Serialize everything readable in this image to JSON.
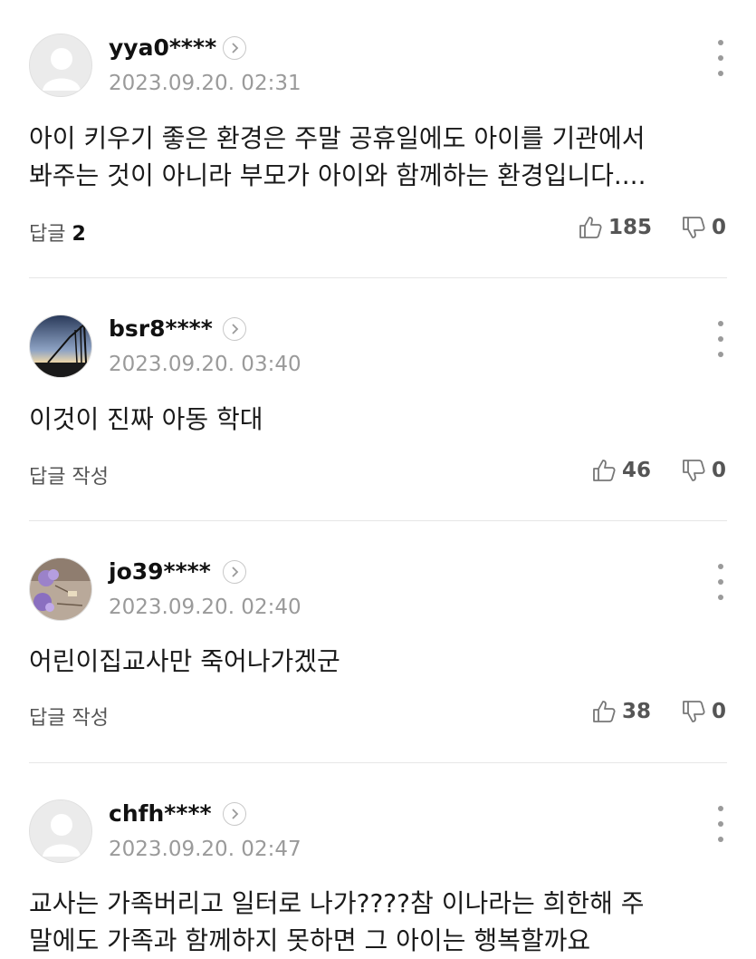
{
  "comments": [
    {
      "username": "yya0****",
      "date": "2023.09.20. 02:31",
      "text_lines": [
        "아이 키우기 좋은 환경은 주말 공휴일에도 아이를 기관에서",
        "봐주는 것이 아니라 부모가 아이와 함께하는 환경입니다...."
      ],
      "reply_label": "답글",
      "reply_count": "2",
      "likes": "185",
      "dislikes": "0",
      "avatar": "default-person-avatar"
    },
    {
      "username": "bsr8****",
      "date": "2023.09.20. 03:40",
      "text_lines": [
        "이것이 진짜 아동 학대"
      ],
      "reply_label": "답글 작성",
      "reply_count": "",
      "likes": "46",
      "dislikes": "0",
      "avatar": "sunset-photo-avatar"
    },
    {
      "username": "jo39****",
      "date": "2023.09.20. 02:40",
      "text_lines": [
        "어린이집교사만 죽어나가겠군"
      ],
      "reply_label": "답글 작성",
      "reply_count": "",
      "likes": "38",
      "dislikes": "0",
      "avatar": "flower-photo-avatar"
    },
    {
      "username": "chfh****",
      "date": "2023.09.20. 02:47",
      "text_lines": [
        "교사는 가족버리고 일터로 나가????참 이나라는 희한해 주",
        "말에도 가족과 함께하지 못하면 그 아이는 행복할까요"
      ],
      "avatar": "default-person-avatar"
    }
  ],
  "icons": {
    "like": "thumbs-up-icon",
    "dislike": "thumbs-down-icon",
    "profile_link": "chevron-right-icon",
    "menu": "more-vertical-icon"
  },
  "colors": {
    "username": "#111111",
    "date": "#9a9a9a",
    "text": "#1a1a1a",
    "divider": "#e6e6e6"
  }
}
